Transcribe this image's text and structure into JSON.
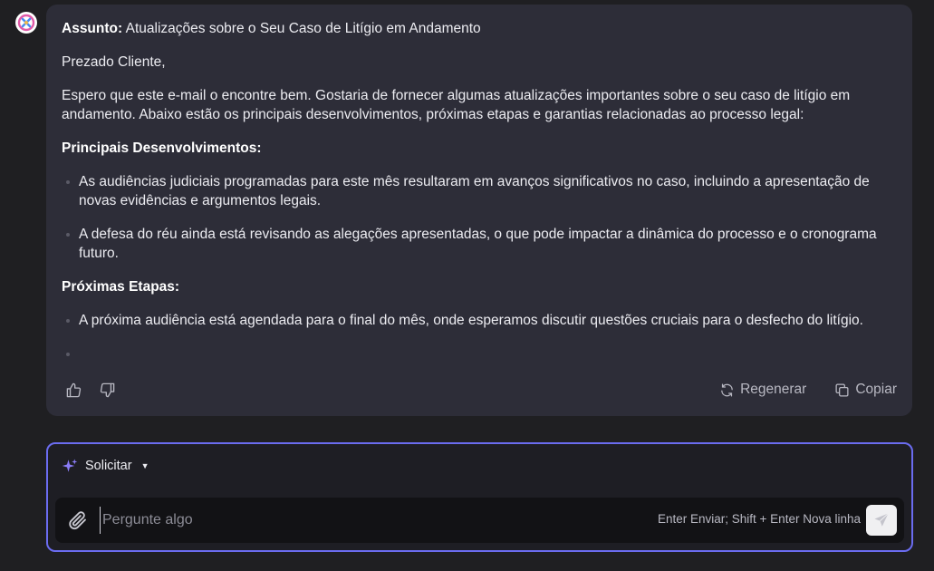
{
  "message": {
    "subject_label": "Assunto:",
    "subject_text": " Atualizações sobre o Seu Caso de Litígio em Andamento",
    "greeting": "Prezado Cliente,",
    "intro": "Espero que este e-mail o encontre bem. Gostaria de fornecer algumas atualizações importantes sobre o seu caso de litígio em andamento. Abaixo estão os principais desenvolvimentos, próximas etapas e garantias relacionadas ao processo legal:",
    "section1_heading": "Principais Desenvolvimentos:",
    "section1_items": [
      "As audiências judiciais programadas para este mês resultaram em avanços significativos no caso, incluindo a apresentação de novas evidências e argumentos legais.",
      "A defesa do réu ainda está revisando as alegações apresentadas, o que pode impactar a dinâmica do processo e o cronograma futuro."
    ],
    "section2_heading": "Próximas Etapas:",
    "section2_items": [
      "A próxima audiência está agendada para o final do mês, onde esperamos discutir questões cruciais para o desfecho do litígio."
    ]
  },
  "actions": {
    "regenerate_label": "Regenerar",
    "copy_label": "Copiar"
  },
  "composer": {
    "prompt_select_label": "Solicitar",
    "input_placeholder": "Pergunte algo",
    "input_value": "",
    "hint": "Enter Enviar; Shift + Enter Nova linha"
  },
  "icons": {
    "avatar": "app-logo-icon",
    "like": "thumbs-up-icon",
    "dislike": "thumbs-down-icon",
    "regenerate": "refresh-icon",
    "copy": "copy-icon",
    "sparkle": "sparkle-icon",
    "attach": "paperclip-icon",
    "send": "send-icon"
  },
  "colors": {
    "accent_border": "#6b6cf0",
    "sparkle": "#8a7cf6",
    "card_bg": "#2d2d38",
    "page_bg": "#1f1f22"
  }
}
